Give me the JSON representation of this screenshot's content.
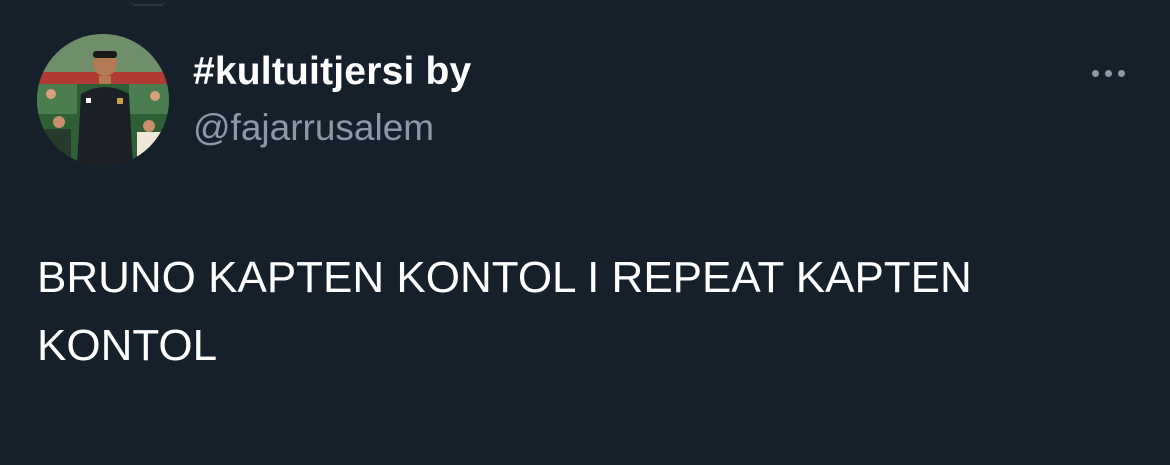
{
  "tweet": {
    "author": {
      "display_name": "#kultuitjersi by",
      "handle": "@fajarrusalem",
      "avatar_icon": "user-photo-avatar"
    },
    "more_icon": "more-horizontal-icon",
    "text": "BRUNO KAPTEN KONTOL I REPEAT KAPTEN\nKONTOL"
  },
  "colors": {
    "background": "#15202b",
    "primary_text": "#ffffff",
    "secondary_text": "#8b98a5"
  }
}
